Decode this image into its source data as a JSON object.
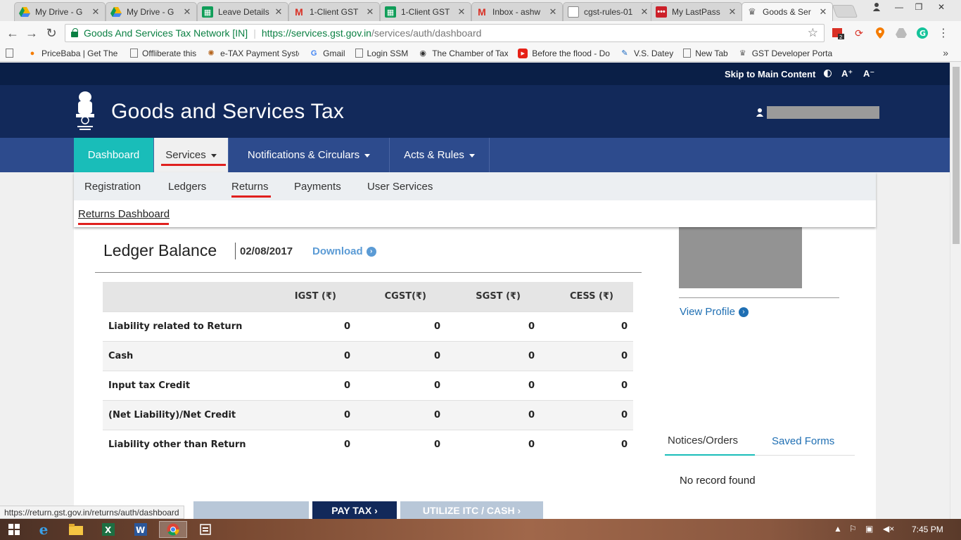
{
  "browser": {
    "tabs": [
      {
        "label": "My Drive - G",
        "favicon": "google-drive-icon",
        "color": "#f4b400"
      },
      {
        "label": "My Drive - G",
        "favicon": "google-drive-icon",
        "color": "#f4b400"
      },
      {
        "label": "Leave Details",
        "favicon": "sheets-icon",
        "color": "#0f9d58"
      },
      {
        "label": "1-Client GST",
        "favicon": "gmail-icon",
        "color": "#d93025"
      },
      {
        "label": "1-Client GST",
        "favicon": "sheets-icon",
        "color": "#0f9d58"
      },
      {
        "label": "Inbox - ashw",
        "favicon": "gmail-icon",
        "color": "#d93025"
      },
      {
        "label": "cgst-rules-01",
        "favicon": "document-icon",
        "color": "#888888"
      },
      {
        "label": "My LastPass",
        "favicon": "lastpass-icon",
        "color": "#cc2029"
      },
      {
        "label": "Goods & Ser",
        "favicon": "gst-emblem-icon",
        "color": "#555555"
      }
    ],
    "omnibox": {
      "site_name": "Goods And Services Tax Network [IN]",
      "url_host": "https://services.gst.gov.in",
      "url_path": "/services/auth/dashboard"
    },
    "extension_badge": "2",
    "bookmarks": [
      {
        "label": "PriceBaba | Get The B",
        "icon": "map-pin-icon"
      },
      {
        "label": "Offliberate this",
        "icon": "page-icon"
      },
      {
        "label": "e-TAX Payment Syste",
        "icon": "etax-icon"
      },
      {
        "label": "Gmail",
        "icon": "google-icon"
      },
      {
        "label": "Login SSM",
        "icon": "page-icon"
      },
      {
        "label": "The Chamber of Tax C",
        "icon": "chamber-icon"
      },
      {
        "label": "Before the flood - Do",
        "icon": "youtube-icon"
      },
      {
        "label": "V.S. Datey",
        "icon": "pen-icon"
      },
      {
        "label": "New Tab",
        "icon": "page-icon"
      },
      {
        "label": "GST Developer Portal",
        "icon": "gst-emblem-icon"
      }
    ],
    "bookmarks_more": "»",
    "status_url": "https://return.gst.gov.in/returns/auth/dashboard"
  },
  "page": {
    "top_strip": {
      "skip_link": "Skip to Main Content",
      "font_increase": "A⁺",
      "font_decrease": "A⁻"
    },
    "header": {
      "title": "Goods and Services Tax"
    },
    "nav": {
      "items": [
        {
          "label": "Dashboard"
        },
        {
          "label": "Services"
        },
        {
          "label": "Notifications & Circulars"
        },
        {
          "label": "Acts & Rules"
        }
      ]
    },
    "submenu": {
      "items": [
        "Registration",
        "Ledgers",
        "Returns",
        "Payments",
        "User Services"
      ],
      "sub_item": "Returns Dashboard"
    },
    "ledger": {
      "title": "Ledger Balance",
      "date": "02/08/2017",
      "download_label": "Download",
      "columns": [
        "",
        "IGST (₹)",
        "CGST(₹)",
        "SGST (₹)",
        "CESS (₹)"
      ],
      "rows": [
        [
          "Liability related to Return",
          "0",
          "0",
          "0",
          "0"
        ],
        [
          "Cash",
          "0",
          "0",
          "0",
          "0"
        ],
        [
          "Input tax Credit",
          "0",
          "0",
          "0",
          "0"
        ],
        [
          "(Net Liability)/Net Credit",
          "0",
          "0",
          "0",
          "0"
        ],
        [
          "Liability other than Return",
          "0",
          "0",
          "0",
          "0"
        ]
      ]
    },
    "sidebar": {
      "view_profile": "View Profile",
      "tabs": [
        "Notices/Orders",
        "Saved Forms"
      ],
      "empty_message": "No record found"
    },
    "actions": {
      "pay_tax": "PAY TAX ›",
      "utilize": "UTILIZE ITC / CASH ›"
    }
  },
  "taskbar": {
    "clock": "7:45 PM"
  },
  "colors": {
    "top_strip": "#0a1f47",
    "header": "#12295a",
    "nav": "#2d4b8d",
    "nav_active": "#19bdb9",
    "highlight_underline": "#e0201e",
    "link": "#1f6fb3"
  }
}
